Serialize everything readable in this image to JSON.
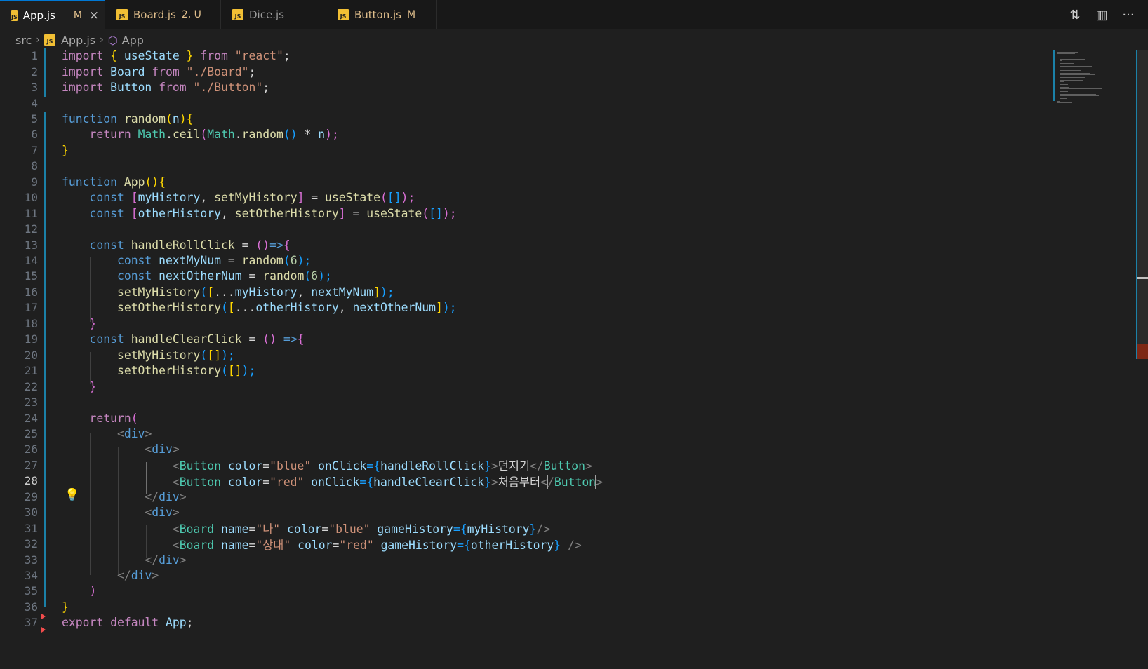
{
  "tabs": [
    {
      "label": "App.js",
      "status": "M",
      "active": true,
      "close": "×"
    },
    {
      "label": "Board.js",
      "status": "2, U",
      "active": false
    },
    {
      "label": "Dice.js",
      "status": "",
      "active": false
    },
    {
      "label": "Button.js",
      "status": "M",
      "active": false
    }
  ],
  "file_icon_text": "JS",
  "tab_actions": {
    "compare_icon": "⇅",
    "split_icon": "▥",
    "more_icon": "···"
  },
  "breadcrumb": {
    "folder": "src",
    "file": "App.js",
    "symbol": "App",
    "sep": "›",
    "symbol_icon": "⬡"
  },
  "editor": {
    "line_numbers": [
      "1",
      "2",
      "3",
      "4",
      "5",
      "6",
      "7",
      "8",
      "9",
      "10",
      "11",
      "12",
      "13",
      "14",
      "15",
      "16",
      "17",
      "18",
      "19",
      "20",
      "21",
      "22",
      "23",
      "24",
      "25",
      "26",
      "27",
      "28",
      "29",
      "30",
      "31",
      "32",
      "33",
      "34",
      "35",
      "36",
      "37"
    ],
    "current_line": 28,
    "lightbulb_icon": "💡",
    "code": {
      "l1": [
        "import",
        "{",
        "useState",
        "}",
        "from",
        "\"react\"",
        ";"
      ],
      "l2": [
        "import",
        "Board",
        "from",
        "\"./Board\"",
        ";"
      ],
      "l3": [
        "import",
        "Button",
        "from",
        "\"./Button\"",
        ";"
      ],
      "l5": [
        "function",
        "random",
        "(",
        "n",
        "){"
      ],
      "l6": [
        "return",
        "Math",
        ".",
        "ceil",
        "(",
        "Math",
        ".",
        "random",
        "()",
        " * ",
        "n",
        ");"
      ],
      "l7": [
        "}"
      ],
      "l9": [
        "function",
        "App",
        "()",
        "{"
      ],
      "l10": [
        "const",
        "[",
        "myHistory",
        ", ",
        "setMyHistory",
        "]",
        " = ",
        "useState",
        "(",
        "[]",
        ");"
      ],
      "l11": [
        "const",
        "[",
        "otherHistory",
        ", ",
        "setOtherHistory",
        "]",
        " = ",
        "useState",
        "(",
        "[]",
        ");"
      ],
      "l13": [
        "const",
        "handleRollClick",
        " = ",
        "()",
        "=>",
        "{"
      ],
      "l14": [
        "const",
        "nextMyNum",
        " = ",
        "random",
        "(",
        "6",
        ");"
      ],
      "l15": [
        "const",
        "nextOtherNum",
        " = ",
        "random",
        "(",
        "6",
        ");"
      ],
      "l16": [
        "setMyHistory",
        "(",
        "[",
        "...",
        "myHistory",
        ", ",
        "nextMyNum",
        "]",
        ");"
      ],
      "l17": [
        "setOtherHistory",
        "(",
        "[",
        "...",
        "otherHistory",
        ", ",
        "nextOtherNum",
        "]",
        ");"
      ],
      "l18": [
        "}"
      ],
      "l19": [
        "const",
        "handleClearClick",
        " = ",
        "()",
        " =>",
        "{"
      ],
      "l20": [
        "setMyHistory",
        "(",
        "[]",
        ");"
      ],
      "l21": [
        "setOtherHistory",
        "(",
        "[]",
        ");"
      ],
      "l22": [
        "}"
      ],
      "l24": [
        "return",
        "("
      ],
      "l25": [
        "<",
        "div",
        ">"
      ],
      "l26": [
        "<",
        "div",
        ">"
      ],
      "l27": [
        "<",
        "Button",
        "color",
        "=",
        "\"blue\"",
        "onClick",
        "={",
        "handleRollClick",
        "}",
        ">",
        "던지기",
        "</",
        "Button",
        ">"
      ],
      "l28": [
        "<",
        "Button",
        "color",
        "=",
        "\"red\"",
        "onClick",
        "={",
        "handleClearClick",
        "}",
        ">",
        "처음부터",
        "<",
        "/",
        "Button",
        ">"
      ],
      "l29": [
        "</",
        "div",
        ">"
      ],
      "l30": [
        "<",
        "div",
        ">"
      ],
      "l31": [
        "<",
        "Board",
        "name",
        "=",
        "\"나\"",
        "color",
        "=",
        "\"blue\"",
        "gameHistory",
        "={",
        "myHistory",
        "}",
        "/>"
      ],
      "l32": [
        "<",
        "Board",
        "name",
        "=",
        "\"상대\"",
        "color",
        "=",
        "\"red\"",
        "gameHistory",
        "={",
        "otherHistory",
        "}",
        " />"
      ],
      "l33": [
        "</",
        "div",
        ">"
      ],
      "l34": [
        "</",
        "div",
        ">"
      ],
      "l35": [
        ")"
      ],
      "l36": [
        "}"
      ],
      "l37": [
        "export",
        "default",
        "App",
        ";"
      ]
    }
  },
  "colors": {
    "keyword_control": "#c586c0",
    "keyword_storage": "#569cd6",
    "function": "#dcdcaa",
    "variable": "#9cdcfe",
    "component": "#4ec9b0",
    "string": "#ce9178",
    "number": "#b5cea8",
    "modified_tab": "#e2c08d",
    "gutter_modified": "#1b81a8"
  }
}
